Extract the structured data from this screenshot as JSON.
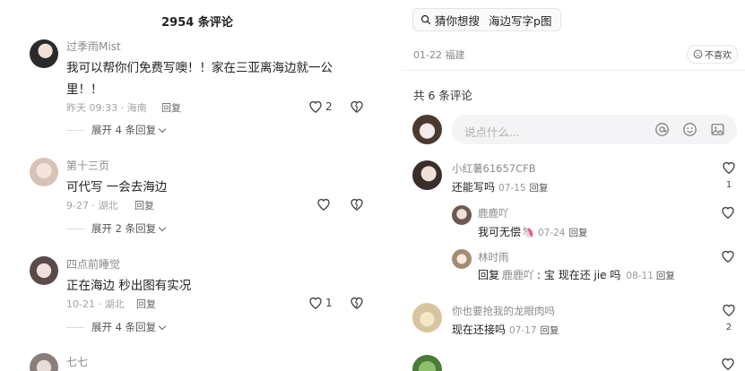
{
  "left": {
    "header": {
      "count_title": "2954 条评论"
    },
    "comments": [
      {
        "name": "过季雨Mist",
        "text_line1": "我可以帮你们免费写噢！！家在三亚离海边就一公",
        "text_line2": "里！！",
        "time": "昨天 09:33 · 海南",
        "reply": "回复",
        "likes": "2",
        "expand": "展开 4 条回复"
      },
      {
        "name": "第十三页",
        "text": "可代写 一会去海边",
        "time": "9-27 · 湖北",
        "reply": "回复",
        "likes": "",
        "expand": "展开 2 条回复"
      },
      {
        "name": "四点前睡觉",
        "text": "正在海边 秒出图有实况",
        "time": "10-21 · 湖北",
        "reply": "回复",
        "likes": "1",
        "expand": "展开 4 条回复"
      },
      {
        "name": "七七"
      }
    ]
  },
  "right": {
    "search": {
      "prefix": "猜你想搜",
      "term": "海边写字p图"
    },
    "post_meta": {
      "date_loc": "01-22 福建",
      "dislike": "不喜欢"
    },
    "comments_count": "共 6 条评论",
    "input": {
      "placeholder": "说点什么..."
    },
    "comments": [
      {
        "name": "小红薯61657CFB",
        "text": "还能写吗",
        "date": "07-15",
        "reply": "回复",
        "likes": "1"
      },
      {
        "name": "鹿鹿吖",
        "text": "我可无偿🦄",
        "date": "07-24",
        "reply": "回复",
        "likes": ""
      },
      {
        "name": "林时雨",
        "text_prefix": "回复",
        "mention": "鹿鹿吖",
        "text": ": 宝 现在还 jie 吗",
        "date": "08-11",
        "reply": "回复",
        "likes": ""
      },
      {
        "name": "你也要抢我的龙眼肉吗",
        "text": "现在还接吗",
        "date": "07-17",
        "reply": "回复",
        "likes": "2"
      }
    ]
  },
  "colors": {
    "accent": "#2f6fd6",
    "muted": "#999999",
    "divider": "#ececec"
  }
}
